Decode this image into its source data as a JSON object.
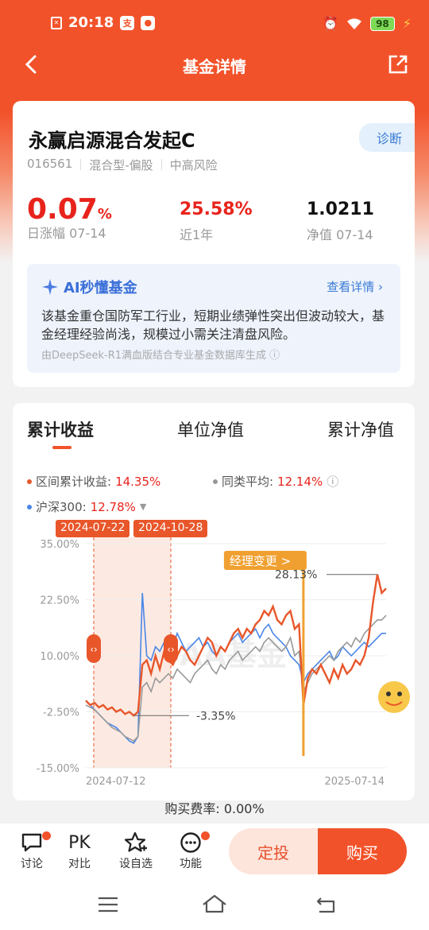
{
  "status": {
    "time": "20:18",
    "battery": "98"
  },
  "nav": {
    "title": "基金详情"
  },
  "fund": {
    "name": "永赢启源混合发起C",
    "diagnose_label": "诊断",
    "code": "016561",
    "type": "混合型-偏股",
    "risk": "中高风险",
    "daily_change": "0.07",
    "daily_change_unit": "%",
    "daily_label": "日涨幅  07-14",
    "year_return": "25.58%",
    "year_label": "近1年",
    "nav_value": "1.0211",
    "nav_label": "净值  07-14"
  },
  "ai": {
    "title": "AI秒懂基金",
    "link": "查看详情 ›",
    "text": "该基金重仓国防军工行业，短期业绩弹性突出但波动较大，基金经理经验尚浅，规模过小需关注清盘风险。",
    "footnote": "由DeepSeek-R1满血版结合专业基金数据库生成 ⓘ"
  },
  "tabs": [
    "累计收益",
    "单位净值",
    "累计净值"
  ],
  "legend": {
    "series1_label": "区间累计收益:",
    "series1_value": "14.35%",
    "series2_label": "同类平均:",
    "series2_value": "12.14%",
    "series3_label": "沪深300:",
    "series3_value": "12.78%"
  },
  "chart_data": {
    "type": "line",
    "y_ticks": [
      "35.00%",
      "22.50%",
      "10.00%",
      "-2.50%",
      "-15.00%"
    ],
    "ylim": [
      -15,
      35
    ],
    "x_labels": [
      "2024-07-12",
      "2025-07-14"
    ],
    "range_start": "2024-07-22",
    "range_end": "2024-10-28",
    "annotation_max": "28.13%",
    "annotation_min": "-3.35%",
    "manager_change_label": "经理变更 >",
    "watermark": "AA基金",
    "series": [
      {
        "name": "区间累计收益",
        "color": "#e8562a",
        "values": [
          0,
          -1,
          -0.5,
          -1.5,
          -1,
          -2,
          -1.5,
          -2.5,
          -2,
          -3,
          -2.5,
          -3.35,
          -2.5,
          8,
          9,
          6,
          10,
          7,
          11,
          9,
          8,
          10,
          12,
          11,
          9,
          8,
          10,
          12,
          14,
          13,
          10,
          12,
          11,
          13,
          15,
          16,
          14,
          16,
          15,
          17,
          18,
          20,
          19,
          21,
          18,
          17,
          19,
          20,
          16,
          17,
          -1,
          5,
          7,
          6,
          8,
          6,
          4,
          7,
          5,
          8,
          6,
          7,
          9,
          8,
          10,
          14,
          22,
          28.13,
          24,
          25
        ]
      },
      {
        "name": "同类平均",
        "color": "#999999",
        "values": [
          -1,
          -1.5,
          -2,
          -3,
          -4,
          -5,
          -6,
          -6.5,
          -7,
          -8,
          -8.5,
          -9,
          -8,
          3,
          4,
          2,
          5,
          4,
          5,
          6,
          5,
          7,
          6,
          5,
          4,
          6,
          7,
          8,
          9,
          7,
          6,
          8,
          7,
          9,
          10,
          11,
          9,
          10,
          11,
          12,
          11,
          13,
          14,
          13,
          12,
          11,
          12,
          14,
          10,
          11,
          2,
          4,
          6,
          7,
          8,
          9,
          10,
          9,
          11,
          12,
          13,
          12,
          14,
          13,
          15,
          16,
          17,
          18,
          18,
          19
        ]
      },
      {
        "name": "沪深300",
        "color": "#4a86e8",
        "values": [
          0,
          -1,
          -2,
          -3,
          -4,
          -5,
          -5.5,
          -6,
          -7,
          -8,
          -9,
          -9.5,
          -8,
          24,
          10,
          9,
          12,
          11,
          13,
          14,
          12,
          15,
          13,
          11,
          12,
          13,
          14,
          12,
          13,
          11,
          10,
          12,
          11,
          13,
          14,
          15,
          13,
          14,
          15,
          16,
          14,
          16,
          17,
          15,
          14,
          13,
          12,
          10,
          9,
          8,
          4,
          6,
          7,
          8,
          9,
          10,
          11,
          9,
          10,
          12,
          11,
          10,
          11,
          12,
          13,
          12,
          13,
          14,
          15,
          15
        ]
      }
    ]
  },
  "fee": {
    "label": "购买费率: 0.00%"
  },
  "bottom": {
    "discuss": "讨论",
    "compare_icon": "PK",
    "compare": "对比",
    "watchlist": "设自选",
    "functions": "功能",
    "sip": "定投",
    "buy": "购买"
  }
}
